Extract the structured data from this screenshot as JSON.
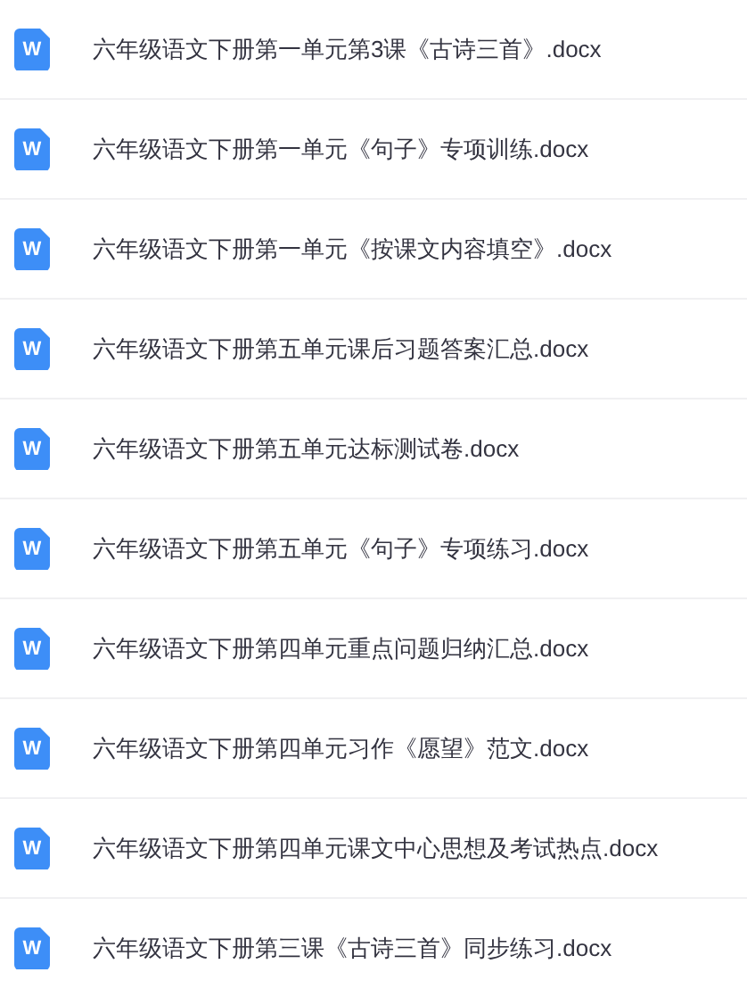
{
  "files": [
    {
      "icon": "W",
      "name": "六年级语文下册第一单元第3课《古诗三首》.docx"
    },
    {
      "icon": "W",
      "name": "六年级语文下册第一单元《句子》专项训练.docx"
    },
    {
      "icon": "W",
      "name": "六年级语文下册第一单元《按课文内容填空》.docx"
    },
    {
      "icon": "W",
      "name": "六年级语文下册第五单元课后习题答案汇总.docx"
    },
    {
      "icon": "W",
      "name": "六年级语文下册第五单元达标测试卷.docx"
    },
    {
      "icon": "W",
      "name": "六年级语文下册第五单元《句子》专项练习.docx"
    },
    {
      "icon": "W",
      "name": "六年级语文下册第四单元重点问题归纳汇总.docx"
    },
    {
      "icon": "W",
      "name": "六年级语文下册第四单元习作《愿望》范文.docx"
    },
    {
      "icon": "W",
      "name": "六年级语文下册第四单元课文中心思想及考试热点.docx"
    },
    {
      "icon": "W",
      "name": "六年级语文下册第三课《古诗三首》同步练习.docx"
    }
  ]
}
